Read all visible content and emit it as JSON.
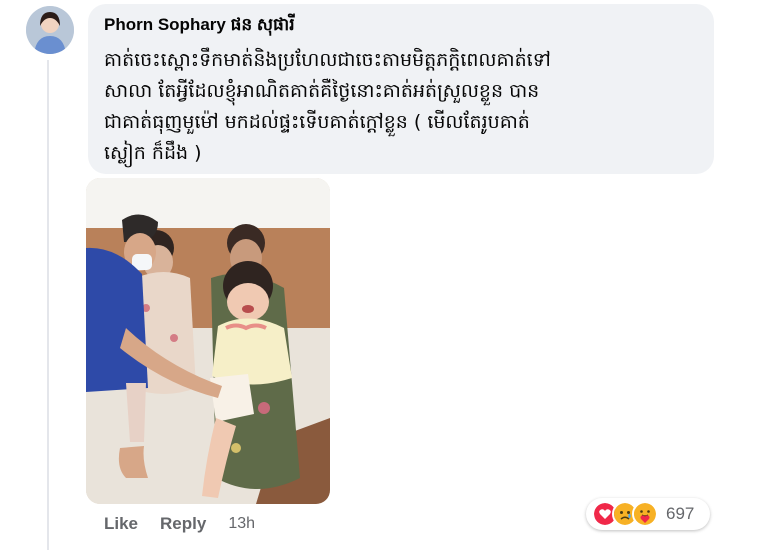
{
  "comment": {
    "author": "Phorn Sophary ផន សុផារី",
    "text": "គាត់ចេះស្ពោះទឹកមាត់និងប្រហែលជាចេះតាមមិត្តភក្តិពេលគាត់ទៅ\nសាលា តែអ្វីដែលខ្ញុំអាណិតគាត់គឺថ្ងៃនោះគាត់អត់ស្រួលខ្លួន បាន\nជាគាត់ធុញមួម៉ៅ មកដល់ផ្ទះទើបគាត់ក្តៅខ្លួន ( មើលតែរូបគាត់\nស្លៀក ក៏ដឹង )",
    "like_label": "Like",
    "reply_label": "Reply",
    "time": "13h",
    "reaction_count": "697",
    "reaction_icons": [
      "heart-icon",
      "sad-icon",
      "care-icon"
    ],
    "colors": {
      "bubble": "#f0f2f5",
      "heart": "#f02849",
      "sad": "#f7b125",
      "meta": "#65676b"
    }
  }
}
